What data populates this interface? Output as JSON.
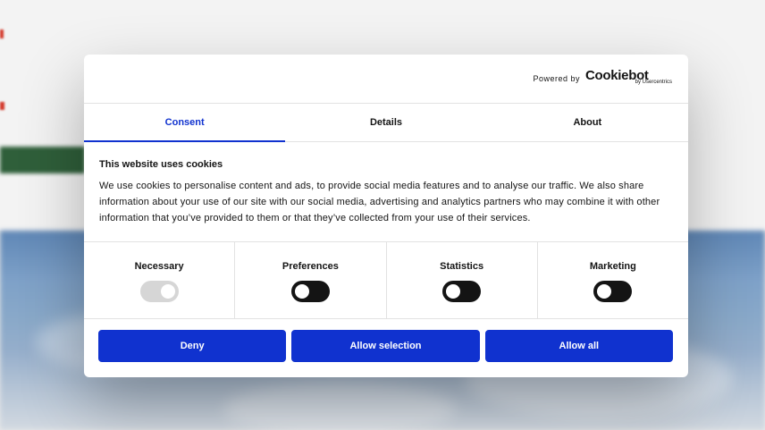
{
  "logo": {
    "powered_by": "Powered by",
    "name": "Cookiebot",
    "by": "by Usercentrics"
  },
  "tabs": [
    {
      "label": "Consent",
      "active": true
    },
    {
      "label": "Details",
      "active": false
    },
    {
      "label": "About",
      "active": false
    }
  ],
  "body": {
    "title": "This website uses cookies",
    "text": "We use cookies to personalise content and ads, to provide social media features and to analyse our traffic. We also share information about your use of our site with our social media, advertising and analytics partners who may combine it with other information that you’ve provided to them or that they’ve collected from your use of their services."
  },
  "toggles": [
    {
      "label": "Necessary",
      "checked": true,
      "disabled": true
    },
    {
      "label": "Preferences",
      "checked": false,
      "disabled": false
    },
    {
      "label": "Statistics",
      "checked": false,
      "disabled": false
    },
    {
      "label": "Marketing",
      "checked": false,
      "disabled": false
    }
  ],
  "buttons": {
    "deny": "Deny",
    "allow_selection": "Allow selection",
    "allow_all": "Allow all"
  },
  "colors": {
    "accent": "#1032cf",
    "text": "#141414",
    "switch_off": "#141414",
    "switch_disabled": "#d6d6d6"
  }
}
